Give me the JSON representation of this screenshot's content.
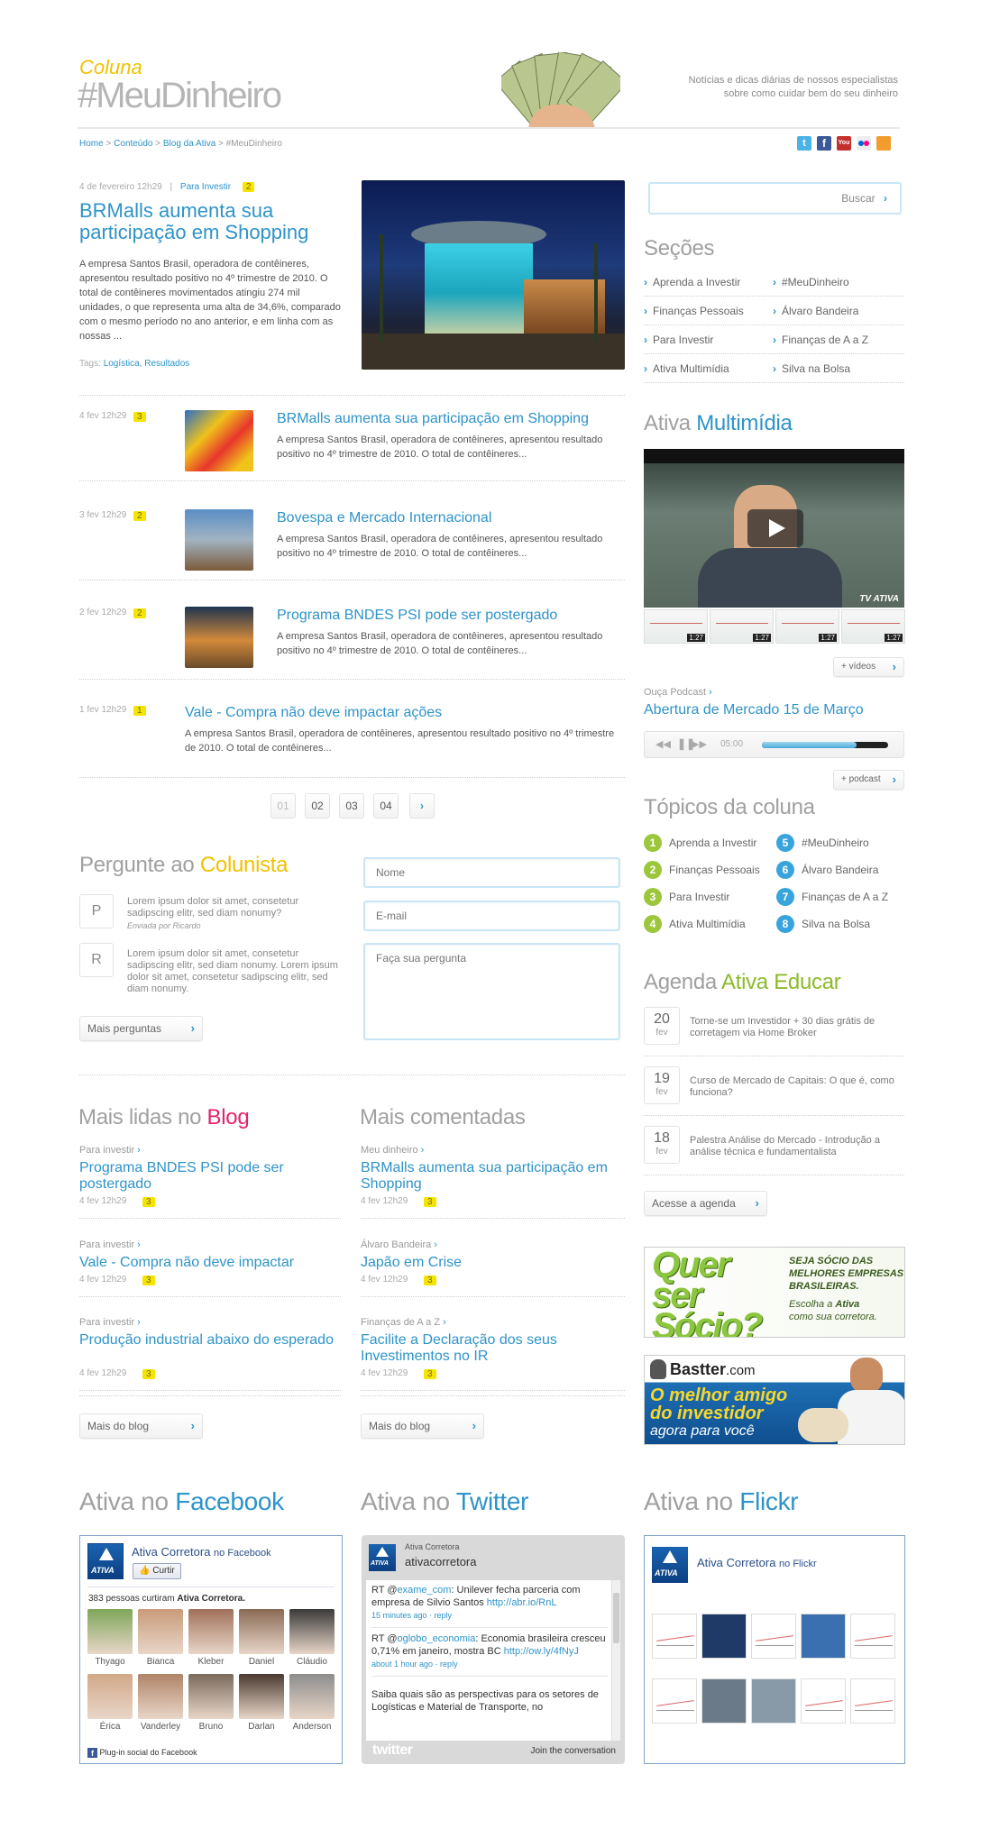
{
  "header": {
    "kicker": "Coluna",
    "title": "#MeuDinheiro",
    "tagline_1": "Notícias e dicas diárias de nossos especialistas",
    "tagline_2": "sobre como cuidar bem do seu dinheiro"
  },
  "breadcrumb": {
    "home": "Home",
    "sep": ">",
    "conteudo": "Conteúdo",
    "blog": "Blog da Ativa",
    "current": "#MeuDinheiro"
  },
  "social_icons": [
    "twitter-icon",
    "facebook-icon",
    "youtube-icon",
    "flickr-icon",
    "orkut-icon"
  ],
  "featured": {
    "date": "4 de fevereiro 12h29",
    "sep": "|",
    "category": "Para Investir",
    "badge": "2",
    "title": "BRMalls aumenta sua participação em Shopping",
    "text": "A empresa Santos Brasil, operadora de contêineres, apresentou resultado positivo no 4º trimestre de 2010. O total de contêineres movimentados atingiu 274 mil unidades, o que representa uma alta de 34,6%, comparado com o mesmo período no ano anterior, e em linha com as nossas ...",
    "tags_label": "Tags:",
    "tags": "Logística, Resultados"
  },
  "posts": [
    {
      "date": "4 fev 12h29",
      "badge": "3",
      "title": "BRMalls aumenta sua participação em Shopping",
      "text": "A empresa Santos Brasil, operadora de contêineres, apresentou resultado positivo no 4º trimestre de 2010. O total de contêineres..."
    },
    {
      "date": "3 fev 12h29",
      "badge": "2",
      "title": "Bovespa e Mercado Internacional",
      "text": "A empresa Santos Brasil, operadora de contêineres, apresentou resultado positivo no 4º trimestre de 2010. O total de contêineres..."
    },
    {
      "date": "2 fev 12h29",
      "badge": "2",
      "title": "Programa BNDES PSI pode ser postergado",
      "text": "A empresa Santos Brasil, operadora de contêineres, apresentou resultado positivo no 4º trimestre de 2010. O total de contêineres..."
    },
    {
      "date": "1 fev 12h29",
      "badge": "1",
      "title": "Vale - Compra não deve impactar ações",
      "text": "A empresa Santos Brasil, operadora de contêineres, apresentou resultado positivo no 4º trimestre de 2010. O total de contêineres..."
    }
  ],
  "pagination": [
    "01",
    "02",
    "03",
    "04"
  ],
  "search": {
    "button": "Buscar"
  },
  "secoes": {
    "title": "Seções",
    "items": [
      "Aprenda a Investir",
      "#MeuDinheiro",
      "Finanças Pessoais",
      "Álvaro Bandeira",
      "Para Investir",
      "Finanças de A a Z",
      "Ativa Multimídia",
      "Silva na Bolsa"
    ]
  },
  "multimidia": {
    "title_a": "Ativa",
    "title_b": "Multimídia",
    "durations": [
      "1:27",
      "1:27",
      "1:27",
      "1:27"
    ],
    "more_videos": "+ vídeos",
    "podcast_label": "Ouça Podcast",
    "podcast_title": "Abertura de Mercado 15 de Março",
    "podcast_time": "05:00",
    "podcast_progress": 0.75,
    "more_podcast": "+ podcast"
  },
  "topicos": {
    "title": "Tópicos da coluna",
    "items": [
      {
        "n": "1",
        "label": "Aprenda a Investir"
      },
      {
        "n": "5",
        "label": "#MeuDinheiro"
      },
      {
        "n": "2",
        "label": "Finanças Pessoais"
      },
      {
        "n": "6",
        "label": "Álvaro Bandeira"
      },
      {
        "n": "3",
        "label": "Para Investir"
      },
      {
        "n": "7",
        "label": "Finanças de A a Z"
      },
      {
        "n": "4",
        "label": "Ativa Multimídia"
      },
      {
        "n": "8",
        "label": "Silva na Bolsa"
      }
    ]
  },
  "pergunte": {
    "title_a": "Pergunte ao",
    "title_b": "Colunista",
    "q1_letter": "P",
    "q1_text": "Lorem ipsum dolor sit amet, consetetur sadipscing elitr, sed diam nonumy?",
    "q1_by": "Enviada por Ricardo",
    "r1_letter": "R",
    "r1_text": "Lorem ipsum dolor sit amet, consetetur sadipscing elitr, sed diam nonumy. Lorem ipsum dolor sit amet, consetetur sadipscing elitr, sed diam nonumy.",
    "more": "Mais perguntas",
    "name_placeholder": "Nome",
    "email_placeholder": "E-mail",
    "question_placeholder": "Faça sua pergunta"
  },
  "agenda": {
    "title_a": "Agenda",
    "title_b": "Ativa Educar",
    "items": [
      {
        "day": "20",
        "month": "fev",
        "text": "Torne-se um Investidor + 30 dias grátis de corretagem via Home Broker"
      },
      {
        "day": "19",
        "month": "fev",
        "text": "Curso de Mercado de Capitais: O que é, como funciona?"
      },
      {
        "day": "18",
        "month": "fev",
        "text": "Palestra Análise do Mercado - Introdução a análise técnica e fundamentalista"
      }
    ],
    "button": "Acesse a agenda"
  },
  "mais_lidas": {
    "title_a": "Mais lidas no",
    "title_b": "Blog",
    "items": [
      {
        "cat": "Para investir",
        "title": "Programa BNDES PSI pode ser postergado",
        "date": "4 fev 12h29",
        "badge": "3"
      },
      {
        "cat": "Para investir",
        "title": "Vale - Compra não deve impactar",
        "date": "4 fev 12h29",
        "badge": "3"
      },
      {
        "cat": "Para investir",
        "title": "Produção industrial abaixo do esperado",
        "date": "4 fev 12h29",
        "badge": "3"
      }
    ],
    "button": "Mais do blog"
  },
  "mais_comentadas": {
    "title": "Mais comentadas",
    "items": [
      {
        "cat": "Meu dinheiro",
        "title": "BRMalls aumenta sua participação em Shopping",
        "date": "4 fev 12h29",
        "badge": "3"
      },
      {
        "cat": "Álvaro Bandeira",
        "title": "Japão em Crise",
        "date": "4 fev 12h29",
        "badge": "3"
      },
      {
        "cat": "Finanças de A a Z",
        "title": "Facilite a Declaração dos seus Investimentos no IR",
        "date": "4 fev 12h29",
        "badge": "3"
      }
    ],
    "button": "Mais do blog"
  },
  "banners": {
    "socio_big": "Quer ser Sócio?",
    "socio_line1": "SEJA SÓCIO DAS",
    "socio_line2": "MELHORES EMPRESAS",
    "socio_line3": "BRASILEIRAS.",
    "socio_line4a": "Escolha a ",
    "socio_brand": "Ativa",
    "socio_line5": "como sua corretora.",
    "bastter_logo": "Bastter",
    "bastter_dom": ".com",
    "bastter_l1": "O melhor amigo",
    "bastter_l2": "do investidor",
    "bastter_l3": "agora para você"
  },
  "facebook": {
    "title_a": "Ativa no",
    "title_b": "Facebook",
    "page_name": "Ativa Corretora",
    "on_fb": "no Facebook",
    "like": "Curtir",
    "count_text": "383 pessoas curtiram",
    "count_name": "Ativa Corretora.",
    "people": [
      "Thyago",
      "Bianca",
      "Kleber",
      "Daniel",
      "Cláudio",
      "Érica",
      "Vanderley",
      "Bruno",
      "Darlan",
      "Anderson"
    ],
    "plugin": "Plug-in social do Facebook"
  },
  "twitter": {
    "title_a": "Ativa no",
    "title_b": "Twitter",
    "name": "Ativa Corretora",
    "handle": "ativacorretora",
    "tweets": [
      {
        "pre": "RT @",
        "user": "exame_com",
        "text": ": Unilever fecha parceria com empresa de Silvio Santos ",
        "link": "http://abr.io/RnL",
        "meta": "15 minutes ago · reply"
      },
      {
        "pre": "RT @",
        "user": "oglobo_economia",
        "text": ": Economia brasileira cresceu 0,71% em janeiro, mostra BC ",
        "link": "http://ow.ly/4fNyJ",
        "meta": "about 1 hour ago · reply"
      },
      {
        "pre": "",
        "user": "",
        "text": "Saiba quais são as perspectivas para os setores de Logísticas e Material de Transporte, no ",
        "link": "",
        "meta": ""
      }
    ],
    "logo": "twitter",
    "join": "Join the conversation"
  },
  "flickr": {
    "title_a": "Ativa no",
    "title_b": "Flickr",
    "name": "Ativa Corretora",
    "on": "no Flickr"
  },
  "brand": "ATIVA",
  "colors": {
    "accent_blue": "#2e93c9",
    "accent_yellow": "#f2c100",
    "accent_pink": "#e2246c",
    "green": "#9cc63b"
  }
}
